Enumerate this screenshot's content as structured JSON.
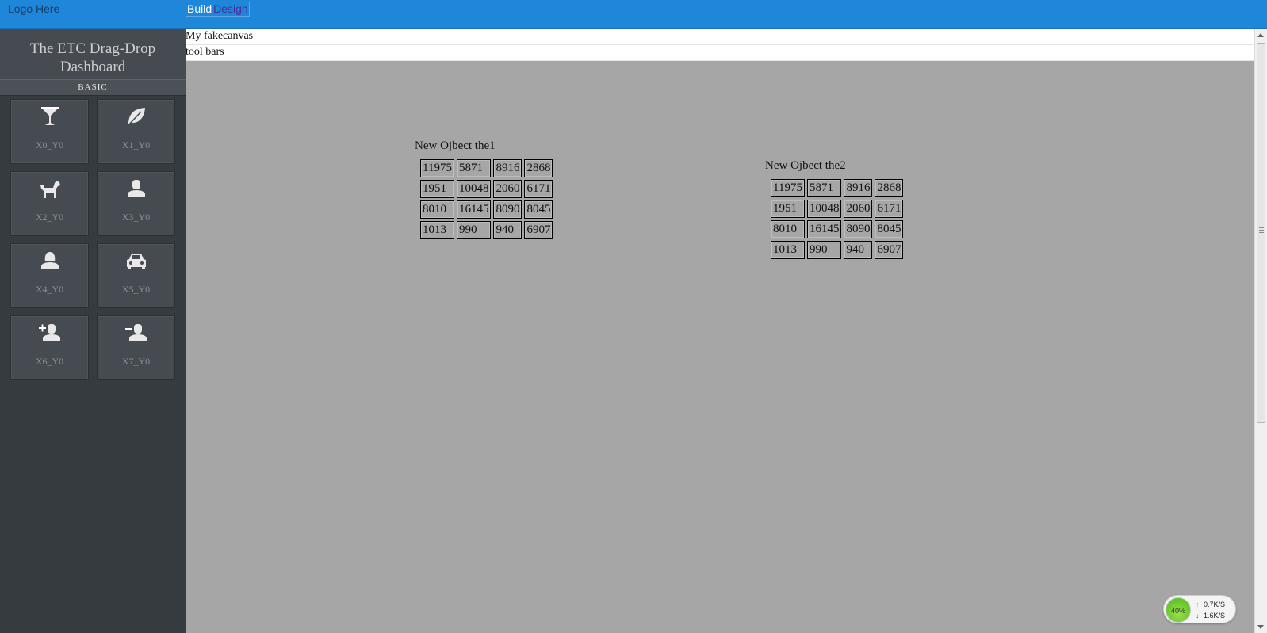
{
  "header": {
    "logo": "Logo Here",
    "tabs": {
      "build": "Build",
      "design": "Design"
    }
  },
  "sidebar": {
    "title_line1": "The ETC Drag-Drop",
    "title_line2": "Dashboard",
    "section": "BASIC",
    "tiles": [
      {
        "label": "X0_Y0",
        "icon": "cocktail-icon"
      },
      {
        "label": "X1_Y0",
        "icon": "leaf-icon"
      },
      {
        "label": "X2_Y0",
        "icon": "dog-icon"
      },
      {
        "label": "X3_Y0",
        "icon": "user-icon"
      },
      {
        "label": "X4_Y0",
        "icon": "user-female-icon"
      },
      {
        "label": "X5_Y0",
        "icon": "car-icon"
      },
      {
        "label": "X6_Y0",
        "icon": "user-add-icon"
      },
      {
        "label": "X7_Y0",
        "icon": "user-remove-icon"
      }
    ]
  },
  "canvas_header": {
    "line1": "My fakecanvas",
    "line2": "tool bars"
  },
  "objects": [
    {
      "title": "New Ojbect the1",
      "rows": [
        [
          "11975",
          "5871",
          "8916",
          "2868"
        ],
        [
          "1951",
          "10048",
          "2060",
          "6171"
        ],
        [
          "8010",
          "16145",
          "8090",
          "8045"
        ],
        [
          "1013",
          "990",
          "940",
          "6907"
        ]
      ]
    },
    {
      "title": "New Ojbect the2",
      "rows": [
        [
          "11975",
          "5871",
          "8916",
          "2868"
        ],
        [
          "1951",
          "10048",
          "2060",
          "6171"
        ],
        [
          "8010",
          "16145",
          "8090",
          "8045"
        ],
        [
          "1013",
          "990",
          "940",
          "6907"
        ]
      ]
    }
  ],
  "net_widget": {
    "percent": "40%",
    "up": "0.7K/S",
    "down": "1.6K/S"
  },
  "colors": {
    "header_blue": "#1f87da",
    "sidebar_dark": "#353b3f",
    "canvas_gray": "#a6a6a6"
  }
}
